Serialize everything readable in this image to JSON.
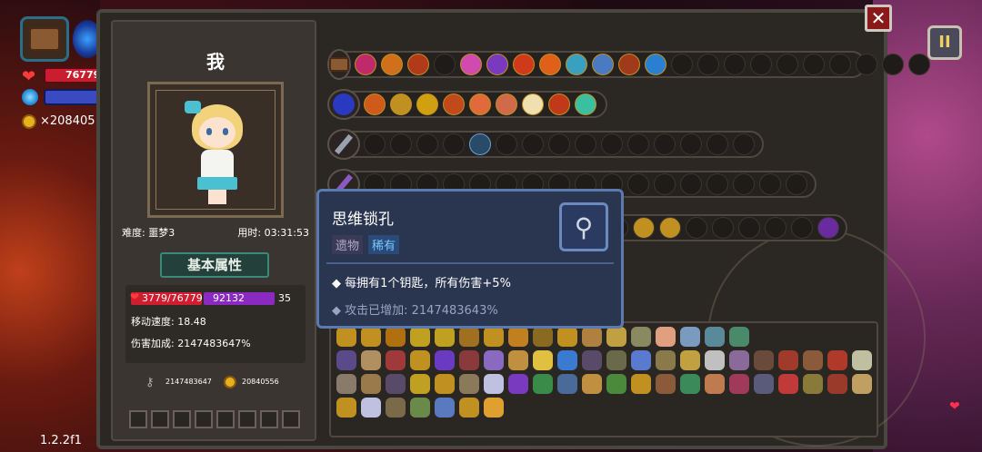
{
  "hud": {
    "hp_value": "76779",
    "gold_value": "×208405"
  },
  "version": "1.2.2f1",
  "player": {
    "name": "我",
    "difficulty": "难度: 噩梦3",
    "time": "用时: 03:31:53",
    "attr_button": "基本属性",
    "hp_text": "3779/76779",
    "mp_text": "92132",
    "mp_extra": "35",
    "move_speed": "移动速度: 18.48",
    "damage_bonus": "伤害加成: 2147483647%",
    "keys": "2147483647",
    "coins": "20840556"
  },
  "tooltip": {
    "title": "思维锁孔",
    "tag_type": "遗物",
    "tag_rarity": "稀有",
    "icon": "key-icon",
    "description": "◆ 每拥有1个钥匙，所有伤害+5%",
    "bonus": "◆ 攻击已增加: 2147483643%"
  },
  "buttons": {
    "close": "✕",
    "pause": "II"
  },
  "colors": {
    "panel_bg": "#2b2824",
    "tooltip_bg": "#2a3550",
    "rarity_blue": "#7ac8ff",
    "hp_red": "#d01e30",
    "mp_purple": "#8a2ac0"
  }
}
